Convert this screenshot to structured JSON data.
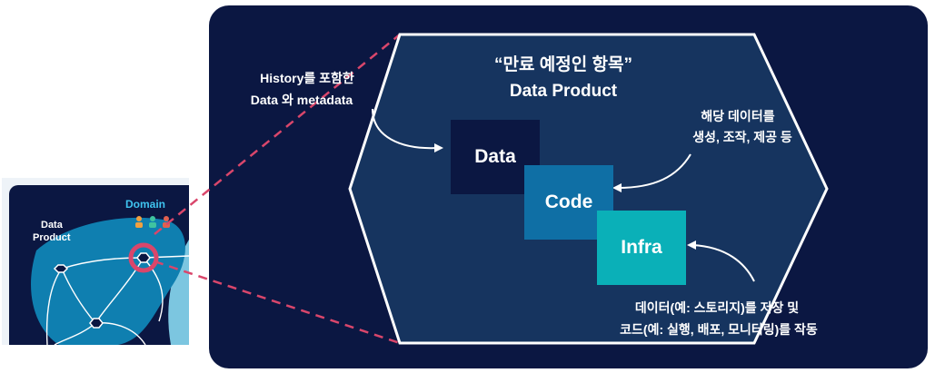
{
  "thumbnail": {
    "domain_label": "Domain",
    "product_label_line1": "Data",
    "product_label_line2": "Product"
  },
  "hexagon": {
    "title_line1": "“만료 예정인 항목”",
    "title_line2": "Data Product"
  },
  "layers": {
    "data": "Data",
    "code": "Code",
    "infra": "Infra"
  },
  "annotations": {
    "history_line1": "History를 포함한",
    "history_line2": "Data 와 metadata",
    "code_line1": "해당 데이터를",
    "code_line2": "생성, 조작, 제공 등",
    "infra_line1": "데이터(예: 스토리지)를 저장 및",
    "infra_line2": "코드(예: 실행, 배포, 모니터링)를 작동"
  },
  "colors": {
    "background_panel": "#0b1742",
    "hexagon_fill": "#16345f",
    "data_box": "#0b1742",
    "code_box": "#0f6fa5",
    "infra_box": "#0ab0b8",
    "domain_label": "#3fc4f0",
    "connector_pink": "#d9466b",
    "domain_blob": "#0f7fb0"
  }
}
